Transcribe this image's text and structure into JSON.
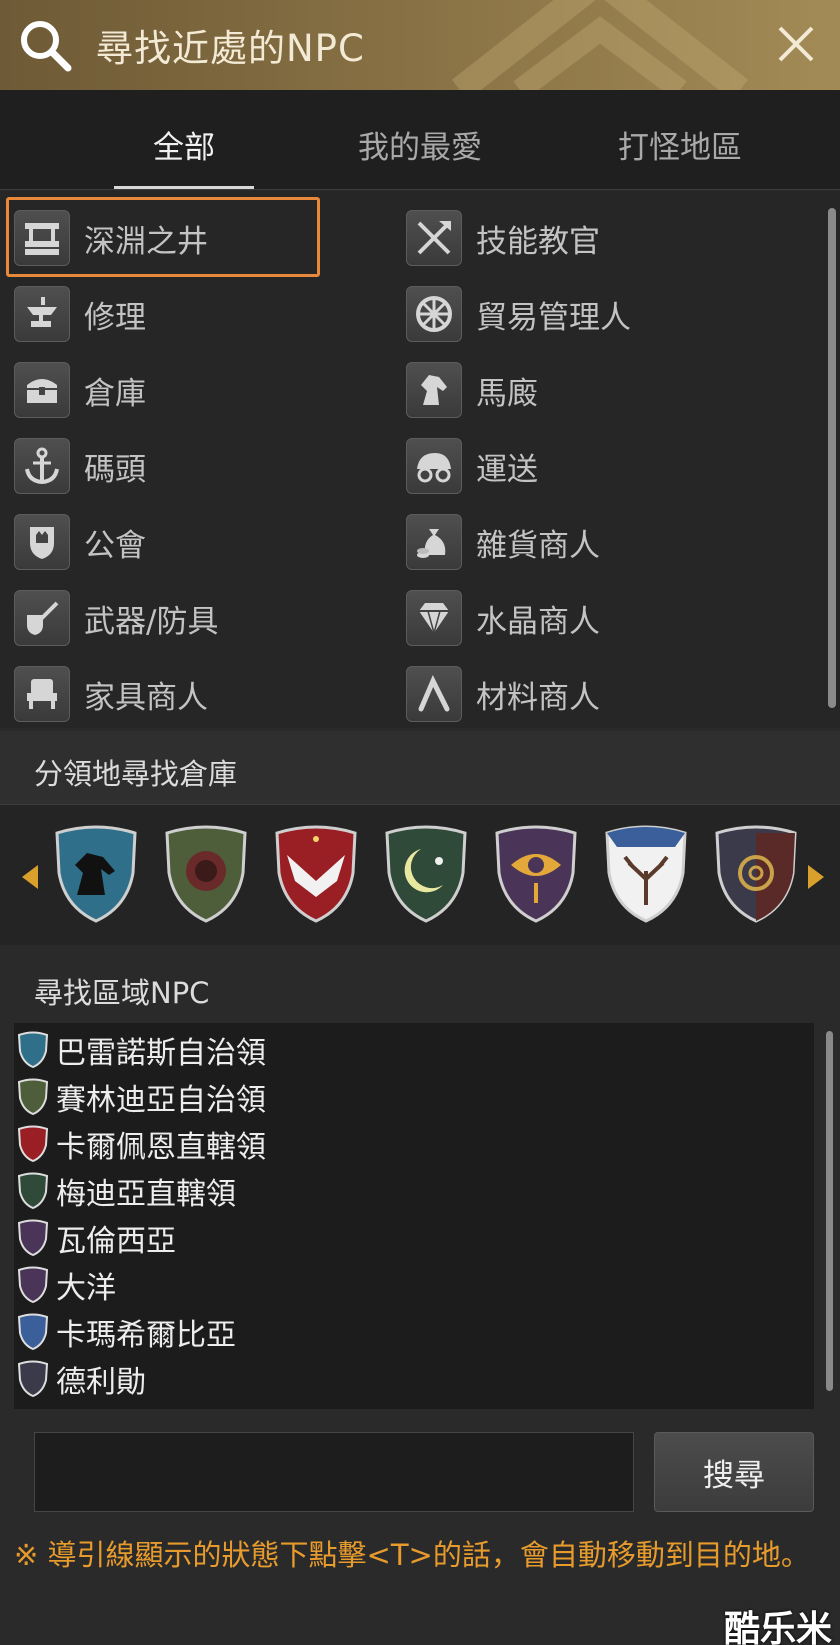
{
  "header": {
    "title": "尋找近處的NPC"
  },
  "tabs": [
    {
      "label": "全部",
      "active": true
    },
    {
      "label": "我的最愛",
      "active": false
    },
    {
      "label": "打怪地區",
      "active": false
    }
  ],
  "npc_items": [
    {
      "label": "深淵之井",
      "icon": "well-icon",
      "selected": true
    },
    {
      "label": "技能教官",
      "icon": "axe-sword-icon"
    },
    {
      "label": "修理",
      "icon": "anvil-icon"
    },
    {
      "label": "貿易管理人",
      "icon": "wheel-icon"
    },
    {
      "label": "倉庫",
      "icon": "chest-icon"
    },
    {
      "label": "馬廄",
      "icon": "horse-icon"
    },
    {
      "label": "碼頭",
      "icon": "anchor-icon"
    },
    {
      "label": "運送",
      "icon": "wagon-icon"
    },
    {
      "label": "公會",
      "icon": "guild-crest-icon"
    },
    {
      "label": "雜貨商人",
      "icon": "money-bag-icon"
    },
    {
      "label": "武器/防具",
      "icon": "sword-shield-icon"
    },
    {
      "label": "水晶商人",
      "icon": "crystal-icon"
    },
    {
      "label": "家具商人",
      "icon": "chair-icon"
    },
    {
      "label": "材料商人",
      "icon": "pickaxe-icon"
    }
  ],
  "warehouse_section": {
    "title": "分領地尋找倉庫"
  },
  "shields": [
    {
      "icon": "horse-shield-icon",
      "color": "#2f6f8a"
    },
    {
      "icon": "lion-shield-icon",
      "color": "#4e5e3a"
    },
    {
      "icon": "eagle-shield-icon",
      "color": "#9a1f25"
    },
    {
      "icon": "moon-shield-icon",
      "color": "#2f4a38"
    },
    {
      "icon": "eye-shield-icon",
      "color": "#4a3458"
    },
    {
      "icon": "antler-shield-icon",
      "color": "#3b5f9a"
    },
    {
      "icon": "knot-shield-icon",
      "color": "#3a3a4a"
    }
  ],
  "region_section": {
    "title": "尋找區域NPC"
  },
  "regions": [
    {
      "label": "巴雷諾斯自治領",
      "color": "#2f6f8a"
    },
    {
      "label": "賽林迪亞自治領",
      "color": "#4e5e3a"
    },
    {
      "label": "卡爾佩恩直轄領",
      "color": "#9a1f25"
    },
    {
      "label": "梅迪亞直轄領",
      "color": "#2f4a38"
    },
    {
      "label": "瓦倫西亞",
      "color": "#4a3458"
    },
    {
      "label": "大洋",
      "color": "#4a3458"
    },
    {
      "label": "卡瑪希爾比亞",
      "color": "#3b5f9a"
    },
    {
      "label": "德利勛",
      "color": "#3a3a4a"
    }
  ],
  "search": {
    "value": "",
    "button_label": "搜尋"
  },
  "notice": "※ 導引線顯示的狀態下點擊<T>的話，會自動移動到目的地。",
  "watermark": "酷乐米"
}
